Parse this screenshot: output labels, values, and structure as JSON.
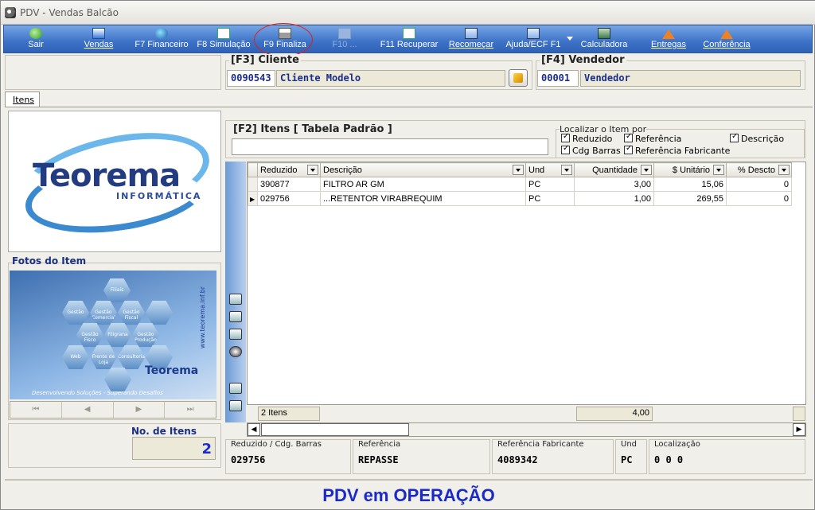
{
  "window": {
    "title": "PDV - Vendas Balcão"
  },
  "toolbar": {
    "buttons": [
      {
        "label": "Sair",
        "icon": "exit-icon"
      },
      {
        "label": "Vendas",
        "icon": "windows-icon"
      },
      {
        "label": "F7 Financeiro",
        "icon": "money-icon"
      },
      {
        "label": "F8 Simulação",
        "icon": "simulation-icon"
      },
      {
        "label": "F9 Finaliza",
        "icon": "printer-icon"
      },
      {
        "label": "F10 ...",
        "icon": "disabled-icon"
      },
      {
        "label": "F11 Recuperar",
        "icon": "recover-icon"
      },
      {
        "label": "Recomeçar",
        "icon": "restart-icon"
      },
      {
        "label": "Ajuda/ECF F1",
        "icon": "help-icon"
      },
      {
        "label": "Calculadora",
        "icon": "calculator-icon"
      },
      {
        "label": "Entregas",
        "icon": "house-icon"
      },
      {
        "label": "Conferência",
        "icon": "house-icon"
      }
    ]
  },
  "cliente": {
    "title": "[F3] Cliente",
    "code": "0090543",
    "name": "Cliente Modelo"
  },
  "vendedor": {
    "title": "[F4] Vendedor",
    "code": "00001",
    "name": "Vendedor"
  },
  "tabs": {
    "itens": "Itens"
  },
  "left": {
    "logo_text": "Teorema",
    "logo_sub": "INFORMÁTICA",
    "fotos_title": "Fotos do Item",
    "photo_logo": "Teorema",
    "photo_url": "www.teorema.inf.br",
    "photo_footer": "Desenvolvendo Soluções - Superando Desafios",
    "hexes": [
      "Gestão Comercial",
      "Gestão Fiscal",
      "Filiais",
      "Gestão Fisco",
      "Filigrana",
      "Gestão Produção",
      "Frente de Loja",
      "Web",
      "Consultoria",
      "Gestão"
    ],
    "no_itens_title": "No. de Itens",
    "no_itens_value": "2"
  },
  "items": {
    "title": "[F2] Itens [ Tabela Padrão ]",
    "search_value": "",
    "locate": {
      "title": "Localizar o Item por",
      "options": [
        {
          "label": "Reduzido",
          "checked": true
        },
        {
          "label": "Referência",
          "checked": true
        },
        {
          "label": "Descrição",
          "checked": true
        },
        {
          "label": "Cdg Barras",
          "checked": true
        },
        {
          "label": "Referência Fabricante",
          "checked": true
        }
      ]
    },
    "columns": [
      "Reduzido",
      "Descrição",
      "Und",
      "Quantidade",
      "$ Unitário",
      "% Descto"
    ],
    "rows": [
      [
        "390877",
        "FILTRO AR GM",
        "PC",
        "3,00",
        "15,06",
        "0"
      ],
      [
        "029756",
        "...RETENTOR VIRABREQUIM",
        "PC",
        "1,00",
        "269,55",
        "0"
      ]
    ],
    "footer_count": "2 Itens",
    "footer_qty": "4,00"
  },
  "detail": {
    "reduzido_label": "Reduzido / Cdg. Barras",
    "reduzido_value": "029756",
    "referencia_label": "Referência",
    "referencia_value": "REPASSE",
    "ref_fab_label": "Referência Fabricante",
    "ref_fab_value": "4089342",
    "und_label": "Und",
    "und_value": "PC",
    "localizacao_label": "Localização",
    "localizacao_value": "0 0 0"
  },
  "status": {
    "text": "PDV em OPERAÇÃO"
  },
  "colors": {
    "toolbar": "#3d72c7",
    "status_text": "#1a2ac8",
    "highlight_circle": "#e0201a"
  }
}
